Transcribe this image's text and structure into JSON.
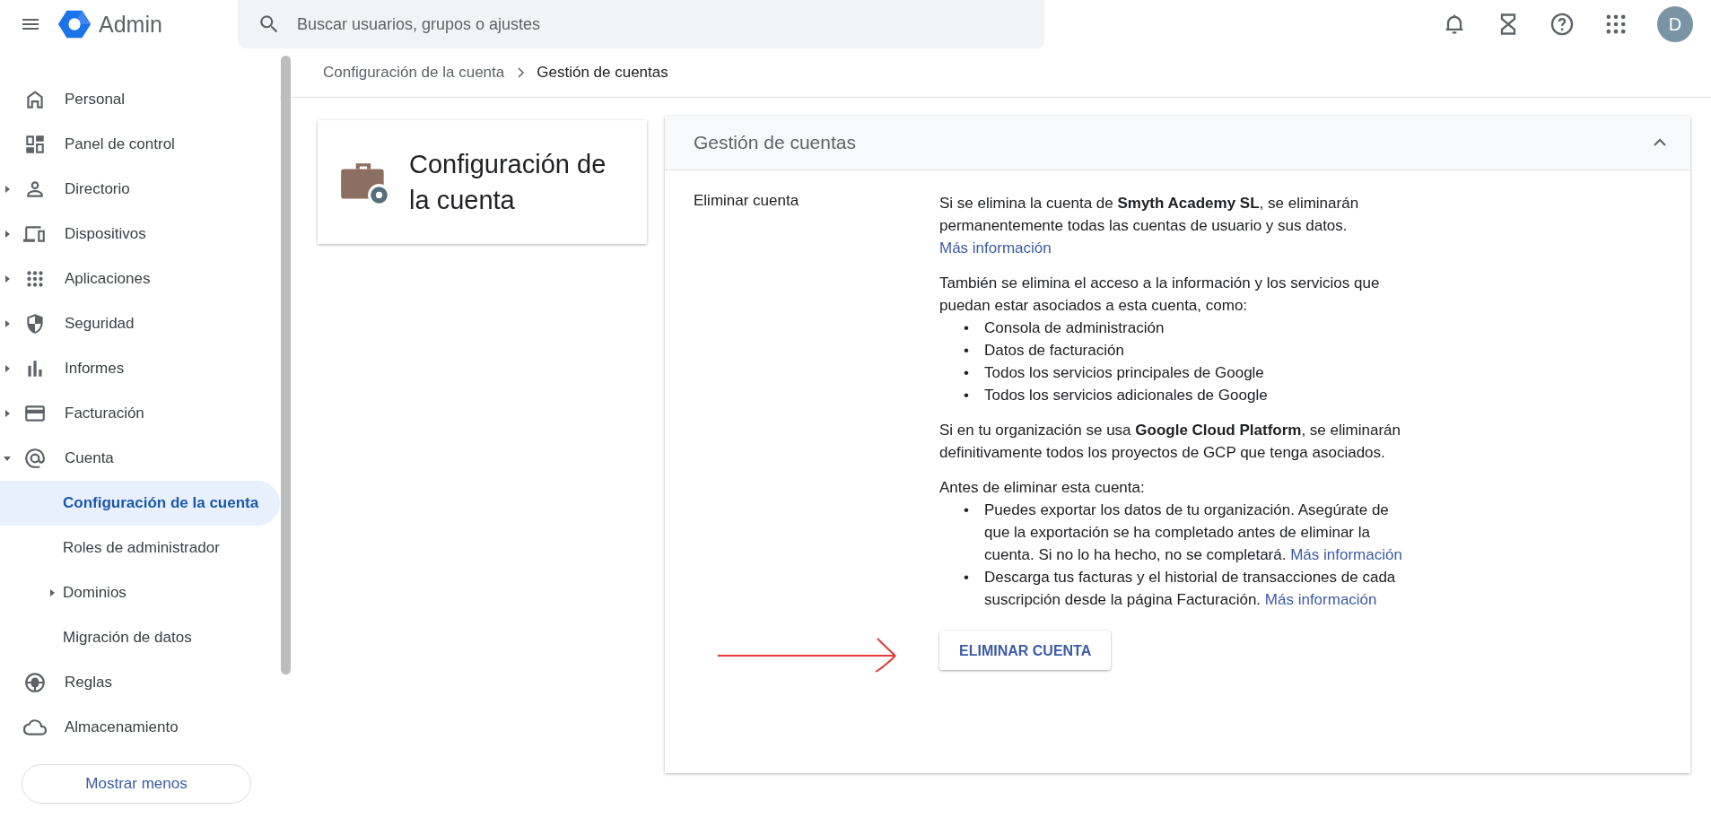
{
  "header": {
    "app_name": "Admin",
    "search": {
      "placeholder": "Buscar usuarios, grupos o ajustes"
    },
    "avatar": "D"
  },
  "sidebar": {
    "items": [
      {
        "label": "Personal",
        "expandable": false,
        "expanded": false,
        "selected": false
      },
      {
        "label": "Panel de control",
        "expandable": false,
        "expanded": false,
        "selected": false
      },
      {
        "label": "Directorio",
        "expandable": true,
        "expanded": false,
        "selected": false
      },
      {
        "label": "Dispositivos",
        "expandable": true,
        "expanded": false,
        "selected": false
      },
      {
        "label": "Aplicaciones",
        "expandable": true,
        "expanded": false,
        "selected": false
      },
      {
        "label": "Seguridad",
        "expandable": true,
        "expanded": false,
        "selected": false
      },
      {
        "label": "Informes",
        "expandable": true,
        "expanded": false,
        "selected": false
      },
      {
        "label": "Facturación",
        "expandable": true,
        "expanded": false,
        "selected": false
      },
      {
        "label": "Cuenta",
        "expandable": true,
        "expanded": true,
        "selected": false,
        "children": [
          {
            "label": "Configuración de la cuenta",
            "expandable": false,
            "expanded": false,
            "selected": true
          },
          {
            "label": "Roles de administrador",
            "expandable": false,
            "expanded": false,
            "selected": false
          },
          {
            "label": "Dominios",
            "expandable": true,
            "expanded": false,
            "selected": false
          },
          {
            "label": "Migración de datos",
            "expandable": false,
            "expanded": false,
            "selected": false
          }
        ]
      },
      {
        "label": "Reglas",
        "expandable": false,
        "expanded": false,
        "selected": false
      },
      {
        "label": "Almacenamiento",
        "expandable": false,
        "expanded": false,
        "selected": false
      }
    ],
    "toggle_button": "Mostrar menos"
  },
  "breadcrumb": [
    "Configuración de la cuenta",
    "Gestión de cuentas"
  ],
  "section_card": {
    "title": "Configuración de la cuenta"
  },
  "panel": {
    "title": "Gestión de cuentas",
    "expanded": true,
    "setting_label": "Eliminar cuenta",
    "paragraph_1": "Si se elimina la cuenta de **Smyth Academy SL**, se eliminarán permanentemente todas las cuentas de usuario y sus datos.",
    "paragraph_1_link": "Más información",
    "paragraph_2": "También se elimina el acceso a la información y los servicios que puedan estar asociados a esta cuenta, como:",
    "list_1": [
      {
        "bullet": "•",
        "text": "Consola de administración"
      },
      {
        "bullet": "•",
        "text": "Datos de facturación"
      },
      {
        "bullet": "•",
        "text": "Todos los servicios principales de Google"
      },
      {
        "bullet": "•",
        "text": "Todos los servicios adicionales de Google"
      }
    ],
    "paragraph_3": "Si en tu organización se usa **Google Cloud Platform**, se eliminarán definitivamente todos los proyectos de GCP que tenga asociados.",
    "paragraph_4": "Antes de eliminar esta cuenta:",
    "list_2": [
      {
        "bullet": "•",
        "text": "Puedes exportar los datos de tu organización. Asegúrate de que la exportación se ha completado antes de eliminar la cuenta. Si no lo ha hecho, no se completará.",
        "link": "Más información"
      },
      {
        "bullet": "•",
        "text": "Descarga tus facturas y el historial de transacciones de cada suscripción desde la página Facturación.",
        "link": "Más información"
      }
    ],
    "button": "ELIMINAR CUENTA"
  }
}
